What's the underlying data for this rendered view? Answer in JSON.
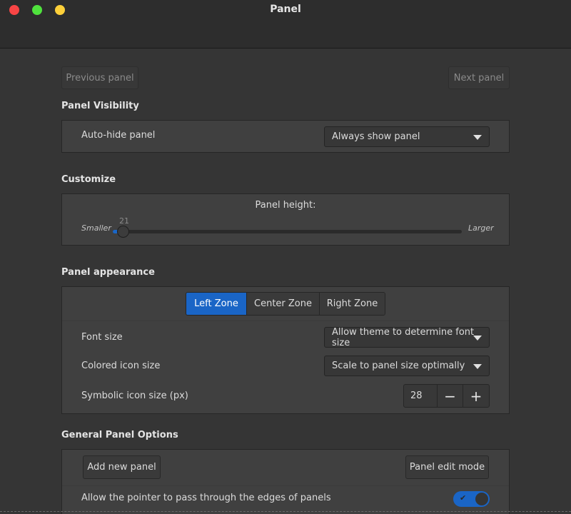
{
  "window": {
    "title": "Panel",
    "controls": {
      "close_color": "#f84545",
      "maximize_color": "#4fe23d",
      "minimize_color": "#fdd03a"
    }
  },
  "nav": {
    "previous_label": "Previous panel",
    "next_label": "Next panel"
  },
  "visibility": {
    "heading": "Panel Visibility",
    "autohide_label": "Auto-hide panel",
    "autohide_value": "Always show panel"
  },
  "customize": {
    "heading": "Customize",
    "height_label": "Panel height:",
    "height_value": "21",
    "height_fraction": 0.01,
    "smaller_label": "Smaller",
    "larger_label": "Larger"
  },
  "appearance": {
    "heading": "Panel appearance",
    "zones": [
      {
        "label": "Left Zone",
        "active": true
      },
      {
        "label": "Center Zone",
        "active": false
      },
      {
        "label": "Right Zone",
        "active": false
      }
    ],
    "font_size_label": "Font size",
    "font_size_value": "Allow theme to determine font size",
    "colored_icon_label": "Colored icon size",
    "colored_icon_value": "Scale to panel size optimally",
    "symbolic_icon_label": "Symbolic icon size (px)",
    "symbolic_icon_value": "28",
    "minus_symbol": "−",
    "plus_symbol": "+"
  },
  "general": {
    "heading": "General Panel Options",
    "add_panel_label": "Add new panel",
    "edit_mode_label": "Panel edit mode",
    "pointer_pass_label": "Allow the pointer to pass through the edges of panels",
    "pointer_pass_enabled": true,
    "check_symbol": "✔"
  },
  "colors": {
    "accent": "#1a65c6",
    "background": "#353535",
    "frame": "#404040"
  }
}
